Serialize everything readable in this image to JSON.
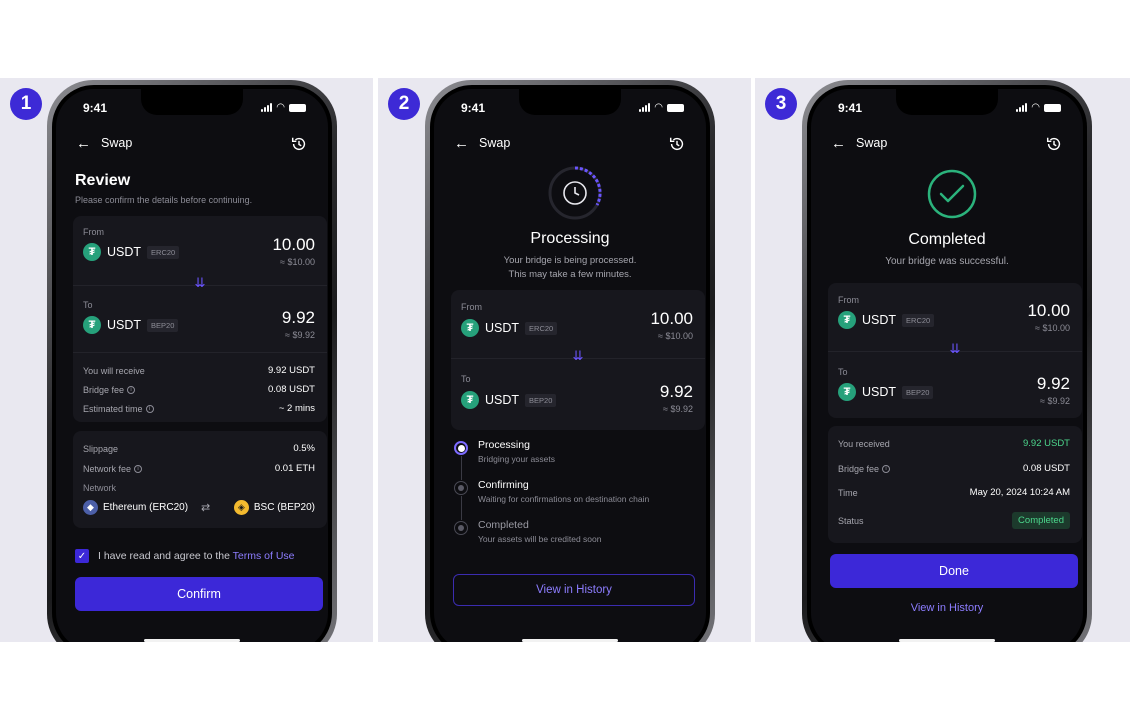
{
  "status_bar": {
    "time": "9:41"
  },
  "screens": [
    {
      "step": "1",
      "header": {
        "title": "Swap"
      },
      "title": "Review",
      "subtitle": "Please confirm the details before continuing.",
      "from": {
        "label": "From",
        "token": "USDT",
        "chip": "ERC20",
        "amount": "10.00",
        "usd": "≈ $10.00"
      },
      "to": {
        "label": "To",
        "token": "USDT",
        "chip": "BEP20",
        "amount": "9.92",
        "usd": "≈ $9.92"
      },
      "details": [
        {
          "label": "You will receive",
          "value": "9.92 USDT"
        },
        {
          "label": "Bridge fee",
          "value": "0.08 USDT"
        },
        {
          "label": "Estimated time",
          "value": "~ 2 mins"
        }
      ],
      "settings": {
        "slippage_label": "Slippage",
        "slippage_value": "0.5%",
        "network_fee_label": "Network fee",
        "network_fee_value": "0.01 ETH",
        "network_label": "Network",
        "network_from": "Ethereum (ERC20)",
        "network_to": "BSC (BEP20)"
      },
      "terms_text": "I have read and agree to the ",
      "terms_link": "Terms of Use",
      "confirm_label": "Confirm"
    },
    {
      "step": "2",
      "header": {
        "title": "Swap"
      },
      "title": "Processing",
      "subtitle_line1": "Your bridge is being processed.",
      "subtitle_line2": "This may take a few minutes.",
      "from": {
        "label": "From",
        "token": "USDT",
        "chip": "ERC20",
        "amount": "10.00",
        "usd": "≈ $10.00"
      },
      "to": {
        "label": "To",
        "token": "USDT",
        "chip": "BEP20",
        "amount": "9.92",
        "usd": "≈ $9.92"
      },
      "timeline": [
        {
          "title": "Processing",
          "subtitle": "Bridging your assets",
          "state": "active"
        },
        {
          "title": "Confirming",
          "subtitle": "Waiting for confirmations on destination chain",
          "state": "pending"
        },
        {
          "title": "Completed",
          "subtitle": "Your assets will be credited soon",
          "state": "pending"
        }
      ],
      "history_label": "View in History"
    },
    {
      "step": "3",
      "header": {
        "title": "Swap"
      },
      "title": "Completed",
      "subtitle": "Your bridge was successful.",
      "from": {
        "label": "From",
        "token": "USDT",
        "chip": "ERC20",
        "amount": "10.00",
        "usd": "≈ $10.00"
      },
      "to": {
        "label": "To",
        "token": "USDT",
        "chip": "BEP20",
        "amount": "9.92",
        "usd": "≈ $9.92"
      },
      "details": {
        "received_label": "You received",
        "received_value": "9.92 USDT",
        "fee_label": "Bridge fee",
        "fee_value": "0.08 USDT",
        "time_label": "Time",
        "time_value": "May 20, 2024 10:24 AM",
        "status_label": "Status",
        "status_value": "Completed"
      },
      "done_label": "Done",
      "history_label": "View in History"
    }
  ],
  "colors": {
    "accent": "#3c28d8",
    "link": "#8d7dff",
    "success": "#4cd68c",
    "tether": "#26a17b",
    "bnb": "#f3ba2f",
    "eth": "#627eea"
  },
  "icons": [
    "back-arrow-icon",
    "history-icon",
    "tether-icon",
    "double-chevron-down-icon",
    "info-icon",
    "ethereum-icon",
    "bnb-icon",
    "swap-arrows-icon",
    "checkbox-checked-icon",
    "clock-icon",
    "check-circle-icon"
  ]
}
